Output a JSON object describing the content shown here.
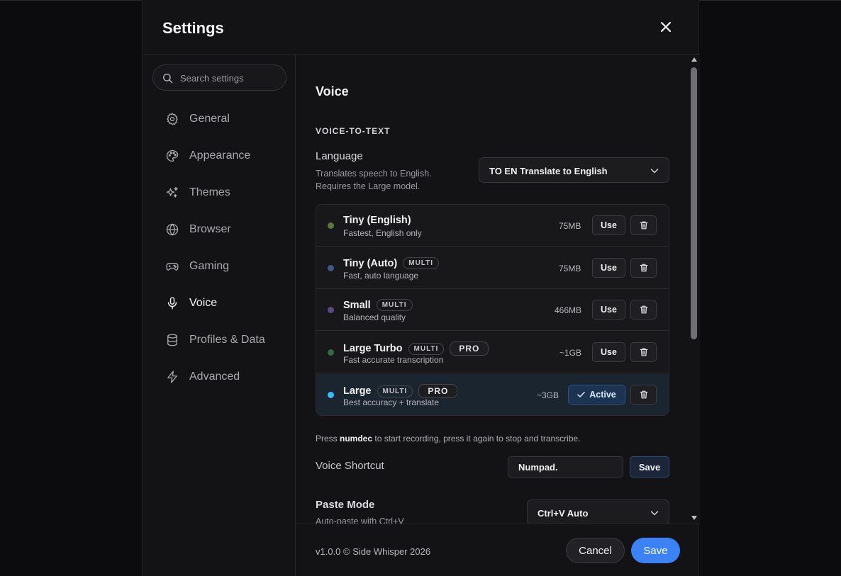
{
  "dialog": {
    "title": "Settings"
  },
  "sidebar": {
    "search_placeholder": "Search settings",
    "items": [
      {
        "label": "General",
        "icon": "gear-icon"
      },
      {
        "label": "Appearance",
        "icon": "palette-icon"
      },
      {
        "label": "Themes",
        "icon": "sparkles-icon"
      },
      {
        "label": "Browser",
        "icon": "globe-icon"
      },
      {
        "label": "Gaming",
        "icon": "gamepad-icon"
      },
      {
        "label": "Voice",
        "icon": "microphone-icon",
        "active": true
      },
      {
        "label": "Profiles & Data",
        "icon": "database-icon"
      },
      {
        "label": "Advanced",
        "icon": "lightning-icon"
      }
    ]
  },
  "content": {
    "section_title": "Voice",
    "group_heading": "VOICE-TO-TEXT",
    "language": {
      "label": "Language",
      "desc_line1": "Translates speech to English.",
      "desc_line2": "Requires the Large model.",
      "selected": "TO EN Translate to English"
    },
    "models": [
      {
        "name": "Tiny (English)",
        "desc": "Fastest, English only",
        "size": "75MB",
        "tags": [],
        "pro": false,
        "action": "Use",
        "dot_color": "#5a7a3a"
      },
      {
        "name": "Tiny (Auto)",
        "desc": "Fast, auto language",
        "size": "75MB",
        "tags": [
          "MULTI"
        ],
        "pro": false,
        "action": "Use",
        "dot_color": "#3d5a80"
      },
      {
        "name": "Small",
        "desc": "Balanced quality",
        "size": "466MB",
        "tags": [
          "MULTI"
        ],
        "pro": false,
        "action": "Use",
        "dot_color": "#5a4a80"
      },
      {
        "name": "Large Turbo",
        "desc": "Fast accurate transcription",
        "size": "~1GB",
        "tags": [
          "MULTI"
        ],
        "pro": true,
        "pro_label": "PRO",
        "action": "Use",
        "dot_color": "#2f6b3f"
      },
      {
        "name": "Large",
        "desc": "Best accuracy + translate",
        "size": "~3GB",
        "tags": [
          "MULTI"
        ],
        "pro": true,
        "pro_label": "PRO",
        "action": "Active",
        "dot_color": "#38bdf8"
      }
    ],
    "hint_pre": "Press ",
    "hint_key": "numdec",
    "hint_post": " to start recording, press it again to stop and transcribe.",
    "shortcut": {
      "label": "Voice Shortcut",
      "value": "Numpad.",
      "save_label": "Save"
    },
    "paste": {
      "label": "Paste Mode",
      "desc": "Auto-paste with Ctrl+V",
      "selected": "Ctrl+V Auto"
    }
  },
  "footer": {
    "version": "v1.0.0 © Side Whisper 2026",
    "cancel_label": "Cancel",
    "save_label": "Save"
  },
  "colors": {
    "accent": "#3b82f6",
    "active_bg": "#1d3352"
  }
}
